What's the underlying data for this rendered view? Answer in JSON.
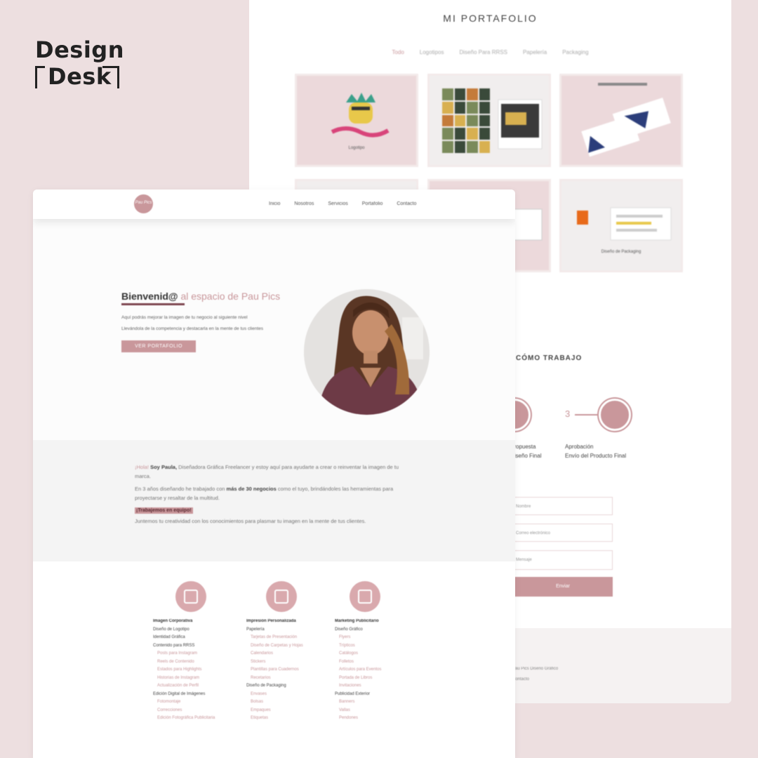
{
  "brand": {
    "line1": "Design",
    "line2": "Desk"
  },
  "colors": {
    "accent": "#c9979b",
    "dark_accent": "#7d4650",
    "background": "#eddfe0"
  },
  "portfolio_page": {
    "title": "MI PORTAFOLIO",
    "nav": [
      "Todo",
      "Logotipos",
      "Diseño Para RRSS",
      "Papelería",
      "Packaging"
    ],
    "tiles": [
      {
        "caption": "Logotipo"
      },
      {
        "caption": ""
      },
      {
        "caption": ""
      },
      {
        "caption": ""
      },
      {
        "caption": ""
      },
      {
        "caption": "Diseño de Packaging"
      }
    ],
    "steps_title": "CÓMO TRABAJO",
    "step3_number": "3",
    "step_list_a": [
      "Propuesta",
      "Diseño Final"
    ],
    "step_list_b": [
      "Aprobación",
      "Envío del Producto Final"
    ],
    "form": {
      "name_placeholder": "Nombre",
      "email_placeholder": "Correo electrónico",
      "message_placeholder": "Mensaje",
      "submit": "Enviar"
    },
    "footer": {
      "line1": "Pau Pics Diseño Gráfico",
      "line2": "Contacto"
    }
  },
  "home_page": {
    "logo_text": "Pau Pics",
    "nav": [
      "Inicio",
      "Nosotros",
      "Servicios",
      "Portafolio",
      "Contacto"
    ],
    "hero": {
      "title_bold": "Bienvenid@",
      "title_rest": " al espacio de Pau Pics",
      "text1": "Aquí podrás mejorar la imagen de tu negocio al siguiente nivel",
      "text2": "Llevándola de la competencia y destacarla en la mente de tus clientes",
      "cta": "VER PORTAFOLIO"
    },
    "about": {
      "greeting": "¡Hola!",
      "name": " Soy Paula,",
      "intro": " Diseñadora Gráfica Freelancer y estoy aquí para ayudarte a crear o reinventar la imagen de tu marca.",
      "p2_a": "En 3 años diseñando he trabajado con",
      "p2_b": " más de 30 negocios",
      "p2_c": " como el tuyo, brindándoles las herramientas para proyectarse y resaltar de la multitud.",
      "tag": "¡Trabajemos en equipo!",
      "p3": "Juntemos tu creatividad con los conocimientos para plasmar tu imagen en la mente de tus clientes."
    },
    "services": [
      {
        "heading": "Imagen Corporativa",
        "groups": [
          {
            "title": "Diseño de Logotipo",
            "items": []
          },
          {
            "title": "Identidad Gráfica",
            "items": []
          },
          {
            "title": "Contenido para RRSS",
            "items": [
              "Posts para Instagram",
              "Reels de Contenido",
              "Estados para Highlights",
              "Historias de Instagram",
              "Actualización de Perfil"
            ]
          },
          {
            "title": "Edición Digital de Imágenes",
            "items": [
              "Fotomontaje",
              "Correcciones",
              "Edición Fotográfica Publicitaria"
            ]
          }
        ]
      },
      {
        "heading": "Impresión Personalizada",
        "groups": [
          {
            "title": "Papelería",
            "items": [
              "Tarjetas de Presentación",
              "Diseño de Carpetas y Hojas",
              "Calendarios",
              "Stickers",
              "Plantillas para Cuadernos",
              "Recetarios"
            ]
          },
          {
            "title": "Diseño de Packaging",
            "items": [
              "Envases",
              "Bolsas",
              "Empaques",
              "Etiquetas"
            ]
          }
        ]
      },
      {
        "heading": "Marketing Publicitario",
        "groups": [
          {
            "title": "Diseño Gráfico",
            "items": [
              "Flyers",
              "Trípticos",
              "Catálogos",
              "Folletos",
              "Artículos para Eventos",
              "Portada de Libros",
              "Invitaciones"
            ]
          },
          {
            "title": "Publicidad Exterior",
            "items": [
              "Banners",
              "Vallas",
              "Pendones"
            ]
          }
        ]
      }
    ]
  }
}
